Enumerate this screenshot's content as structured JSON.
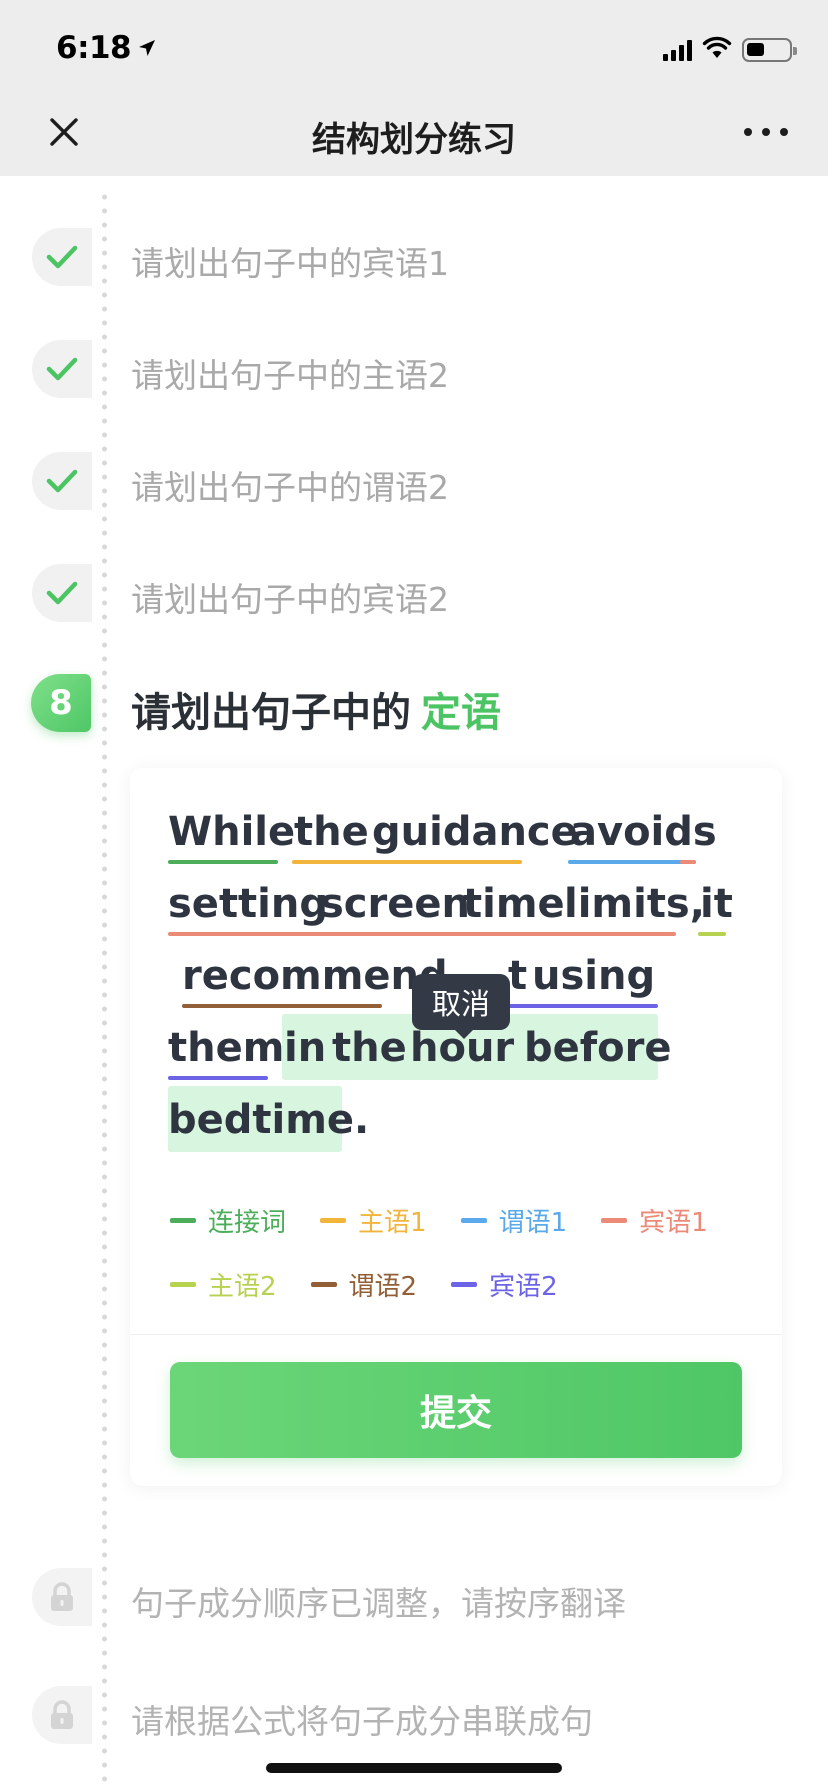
{
  "status": {
    "time": "6:18"
  },
  "nav": {
    "title": "结构划分练习"
  },
  "steps_done": [
    {
      "label": "请划出句子中的宾语1"
    },
    {
      "label": "请划出句子中的主语2"
    },
    {
      "label": "请划出句子中的谓语2"
    },
    {
      "label": "请划出句子中的宾语2"
    }
  ],
  "active_step": {
    "number": "8",
    "title_prefix": "请划出句子中的",
    "title_highlight": "定语"
  },
  "sentence": {
    "words": [
      "While",
      "the",
      "guidance",
      "avoids",
      "setting",
      "screen",
      "time",
      "limits,",
      "it",
      "recommend",
      "t",
      "using",
      "them",
      "in",
      "the",
      "hour",
      "before",
      "bedtime."
    ]
  },
  "tooltip": {
    "label": "取消"
  },
  "legend": [
    {
      "label": "连接词",
      "color": "#4cae5a"
    },
    {
      "label": "主语1",
      "color": "#f2b53c"
    },
    {
      "label": "谓语1",
      "color": "#5aa9ea"
    },
    {
      "label": "宾语1",
      "color": "#ec8a78"
    },
    {
      "label": "主语2",
      "color": "#b7d150"
    },
    {
      "label": "谓语2",
      "color": "#935f37"
    },
    {
      "label": "宾语2",
      "color": "#6c63e6"
    }
  ],
  "submit": {
    "label": "提交"
  },
  "steps_locked": [
    {
      "label": "句子成分顺序已调整，请按序翻译"
    },
    {
      "label": "请根据公式将句子成分串联成句"
    }
  ]
}
